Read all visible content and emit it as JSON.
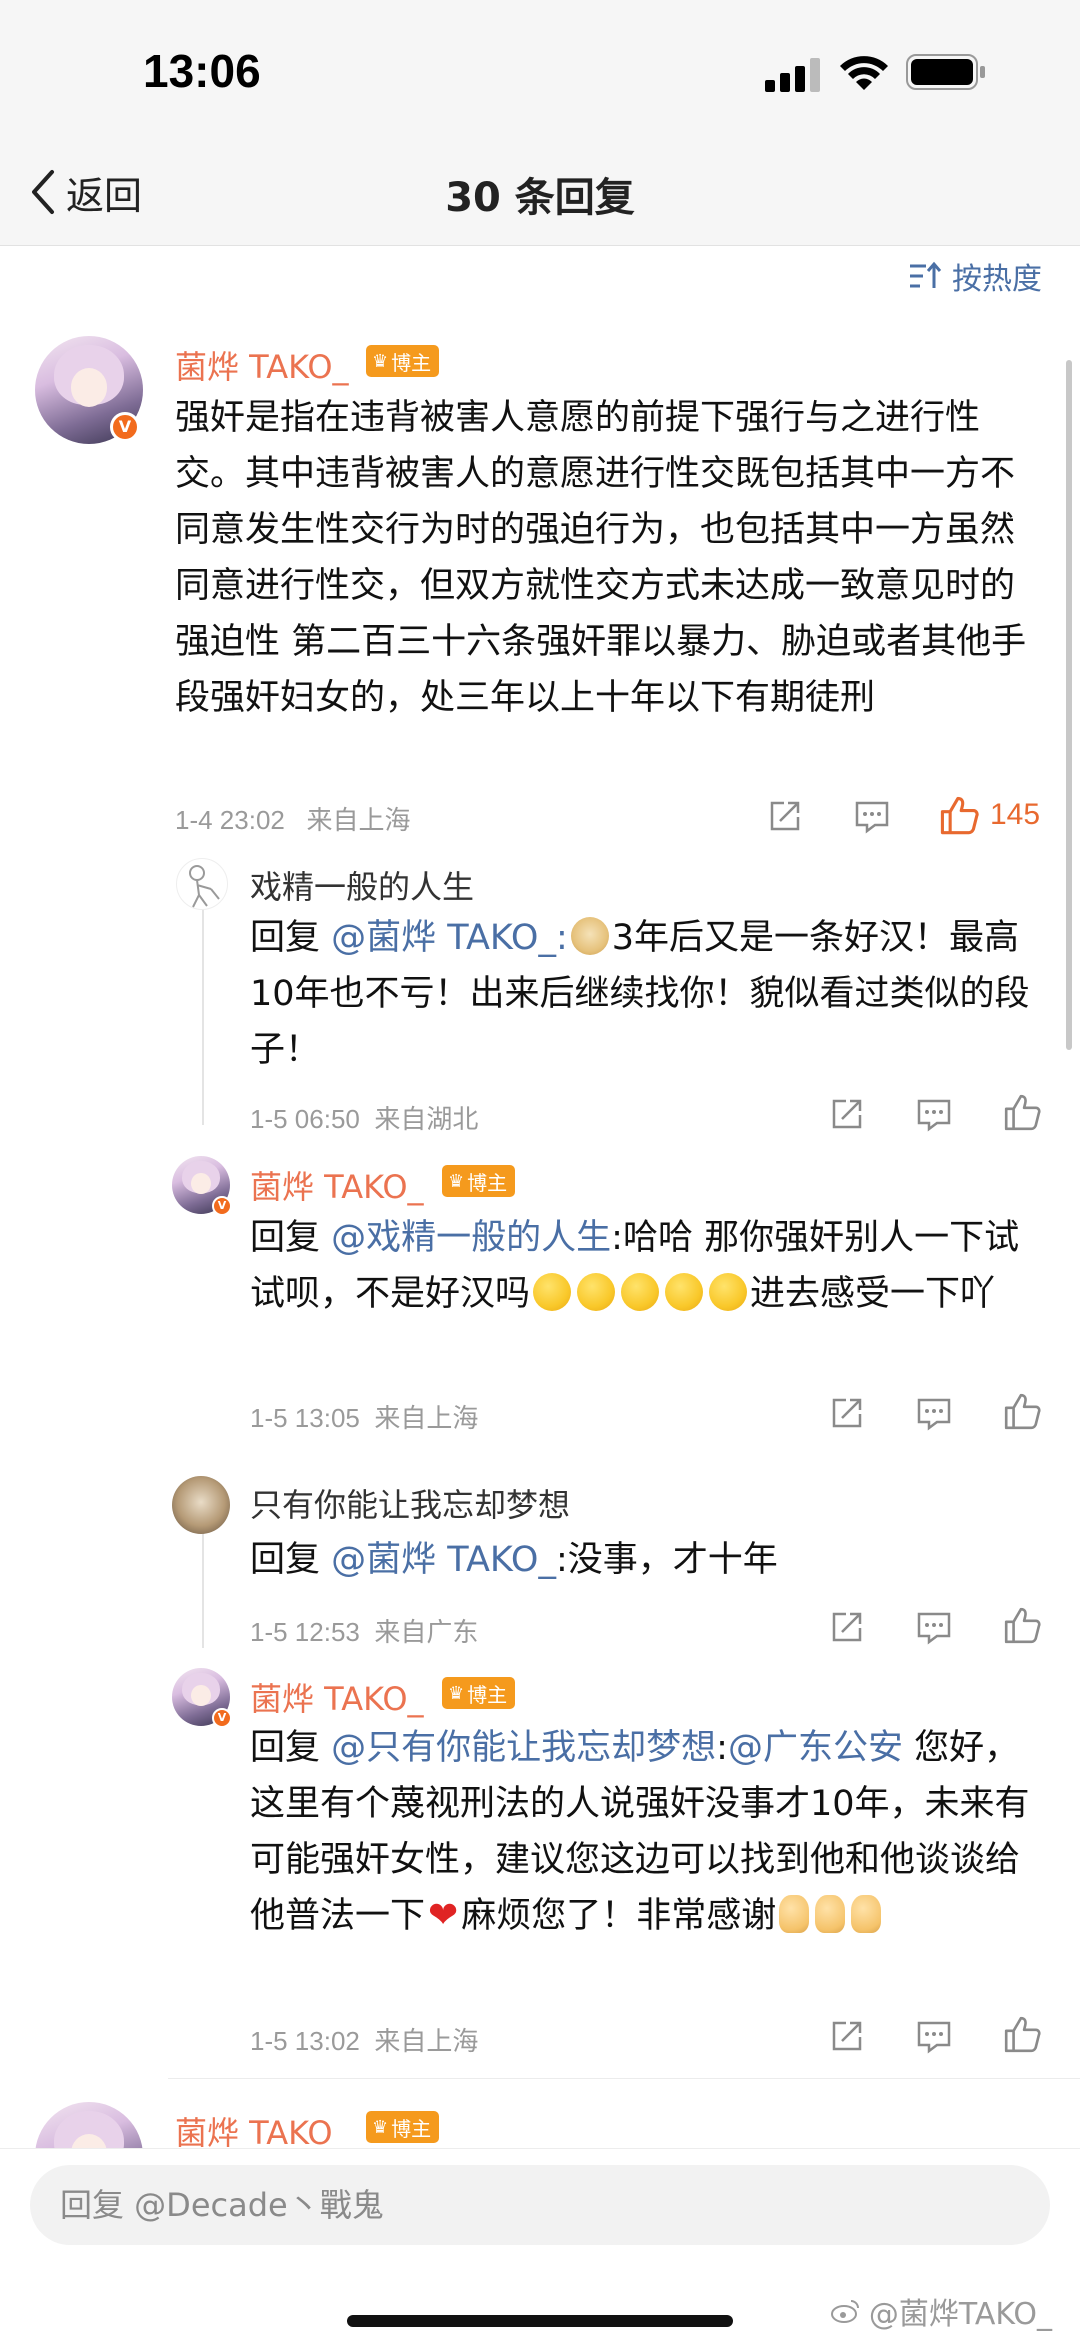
{
  "status_bar": {
    "time": "13:06"
  },
  "nav": {
    "back_label": "返回",
    "title": "30 条回复"
  },
  "sort": {
    "label": "按热度"
  },
  "main_comment": {
    "username": "菌烨 TAKO_",
    "badge": "博主",
    "text": "强奸是指在违背被害人意愿的前提下强行与之进行性交。其中违背被害人的意愿进行性交既包括其中一方不同意发生性交行为时的强迫行为，也包括其中一方虽然同意进行性交，但双方就性交方式未达成一致意见时的强迫性 第二百三十六条强奸罪以暴力、胁迫或者其他手段强奸妇女的，处三年以上十年以下有期徒刑",
    "time": "1-4 23:02",
    "location": "来自上海",
    "likes": "145"
  },
  "replies": [
    {
      "username": "戏精一般的人生",
      "reply_prefix": "回复",
      "mention": "@菌烨 TAKO_",
      "text_after": ":",
      "text": "3年后又是一条好汉！最高10年也不亏！出来后继续找你！貌似看过类似的段子！",
      "time": "1-5 06:50",
      "location": "来自湖北"
    },
    {
      "username": "菌烨 TAKO_",
      "badge": "博主",
      "reply_prefix": "回复",
      "mention": "@戏精一般的人生",
      "text": ":哈哈 那你强奸别人一下试试呗，不是好汉吗",
      "text_after_emoji": "进去感受一下吖",
      "time": "1-5 13:05",
      "location": "来自上海"
    },
    {
      "username": "只有你能让我忘却梦想",
      "reply_prefix": "回复",
      "mention": "@菌烨 TAKO_",
      "text": ":没事，才十年",
      "time": "1-5 12:53",
      "location": "来自广东"
    },
    {
      "username": "菌烨 TAKO_",
      "badge": "博主",
      "reply_prefix": "回复",
      "mention": "@只有你能让我忘却梦想",
      "text_colon": ":",
      "mention2": "@广东公安",
      "text": " 您好，这里有个蔑视刑法的人说强奸没事才10年，未来有可能强奸女性，建议您这边可以找到他和他谈谈给他普法一下",
      "text_after_emoji": "麻烦您了！非常感谢",
      "time": "1-5 13:02",
      "location": "来自上海"
    }
  ],
  "next_comment": {
    "username": "菌烨 TAKO_",
    "badge": "博主"
  },
  "bottom": {
    "reply_placeholder": "回复 @Decade丶戰鬼",
    "watermark": "@菌烨TAKO_"
  },
  "colors": {
    "accent_orange": "#eb7350",
    "link_blue": "#4a6fa5",
    "meta_gray": "#9a9a9a",
    "badge_orange": "#f59a1d"
  },
  "icons": [
    "chevron-left-icon",
    "sort-icon",
    "share-icon",
    "comment-icon",
    "like-icon",
    "verified-icon",
    "crown-icon",
    "weibo-icon"
  ]
}
